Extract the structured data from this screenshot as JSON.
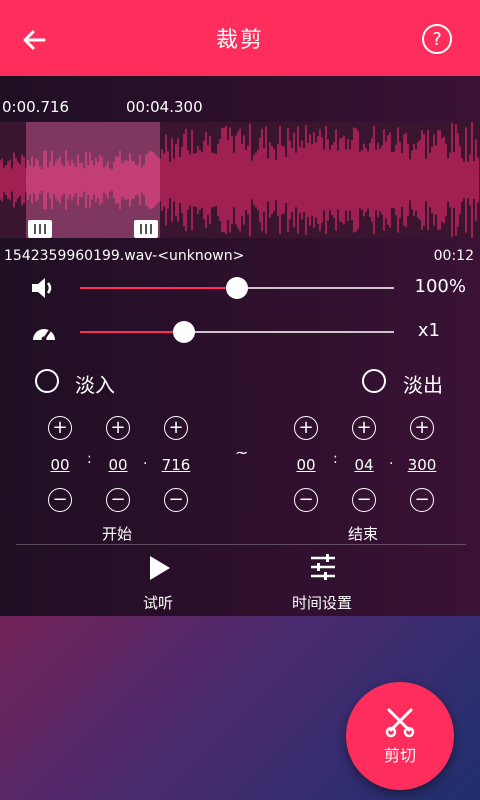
{
  "header": {
    "title": "裁剪",
    "help_icon": "?"
  },
  "waveform": {
    "start_time": "0:00.716",
    "end_time": "00:04.300",
    "selection_start_fraction": 0.054,
    "selection_end_fraction": 0.333
  },
  "file": {
    "name": "1542359960199.wav-<unknown>",
    "duration": "00:12"
  },
  "volume": {
    "value_label": "100%",
    "fraction": 0.5,
    "icon": "speaker-icon"
  },
  "speed": {
    "value_label": "x1",
    "fraction": 0.33,
    "icon": "speedometer-icon"
  },
  "fade": {
    "in_label": "淡入",
    "out_label": "淡出"
  },
  "start": {
    "label": "开始",
    "min": "00",
    "sec": "00",
    "ms": "716"
  },
  "end": {
    "label": "结束",
    "min": "00",
    "sec": "04",
    "ms": "300"
  },
  "separators": {
    "colon": ":",
    "dot": "·",
    "tilde": "~"
  },
  "actions": {
    "preview_label": "试听",
    "time_settings_label": "时间设置"
  },
  "fab": {
    "label": "剪切"
  },
  "colors": {
    "accent": "#ff2d5c"
  }
}
